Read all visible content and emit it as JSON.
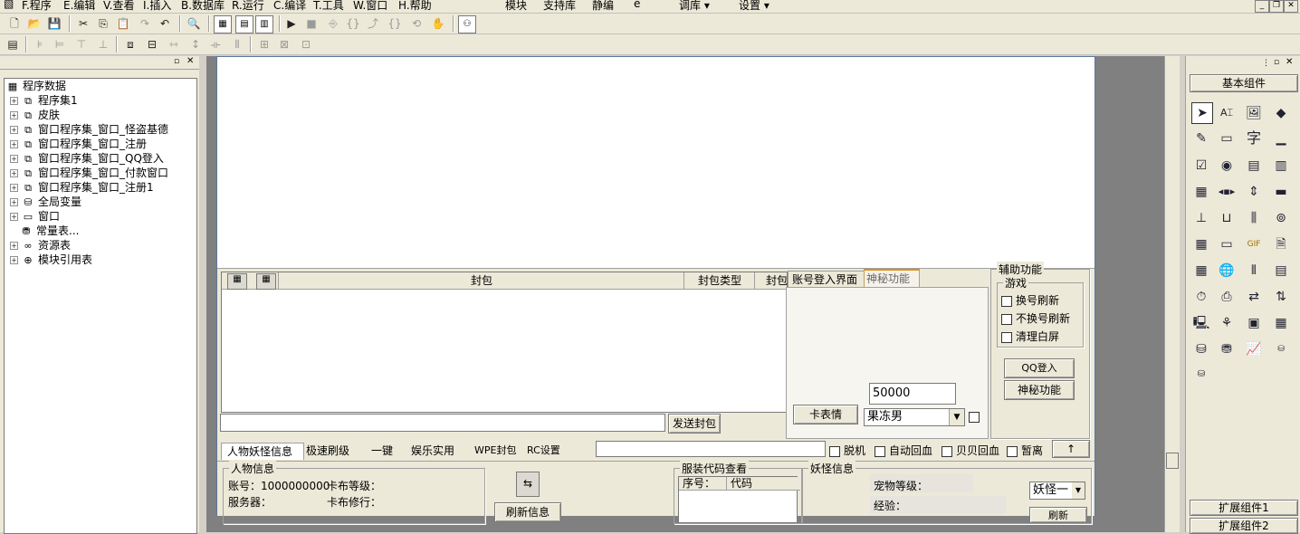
{
  "menu": {
    "items": [
      "F.程序",
      "E.编辑",
      "V.查看",
      "I.插入",
      "B.数据库",
      "R.运行",
      "C.编译",
      "T.工具",
      "W.窗口",
      "H.帮助",
      "模块",
      "支持库",
      "静编",
      "e"
    ],
    "extra": [
      "调库",
      "设置"
    ]
  },
  "icons": {
    "toolbar1": [
      "new-file-icon",
      "open-folder-icon",
      "save-icon",
      "cut-icon",
      "copy-icon",
      "paste-icon",
      "redo-icon",
      "undo-icon",
      "find-icon",
      "window-layout-1-icon",
      "window-layout-2-icon",
      "window-layout-3-icon",
      "run-icon",
      "stop-icon",
      "step-icon",
      "step-into-icon",
      "step-out-icon",
      "run-to-cursor-icon",
      "breakpoint-icon",
      "hand-icon",
      "binoculars-icon"
    ],
    "toolbar2": [
      "form-icon",
      "align-left-icon",
      "align-right-icon",
      "align-top-icon",
      "align-bottom-icon",
      "center-h-icon",
      "center-v-icon",
      "same-width-icon",
      "same-height-icon",
      "space-h-icon",
      "space-v-icon",
      "grid-icon"
    ]
  },
  "tree": {
    "root": "程序数据",
    "nodes": [
      "程序集1",
      "皮肤",
      "窗口程序集_窗口_怪盗基德",
      "窗口程序集_窗口_注册",
      "窗口程序集_窗口_QQ登入",
      "窗口程序集_窗口_付款窗口",
      "窗口程序集_窗口_注册1",
      "全局变量",
      "窗口",
      "常量表...",
      "资源表",
      "模块引用表"
    ]
  },
  "packet": {
    "columns": [
      "封包",
      "封包类型",
      "封包"
    ],
    "send_label": "发送封包",
    "input_value": ""
  },
  "acct_tabs": {
    "tab1": "账号登入界面",
    "tab2": "神秘功能",
    "card_button": "卡表情",
    "number_value": "50000",
    "combo_value": "果冻男"
  },
  "aux": {
    "title": "辅助功能",
    "game_title": "游戏",
    "checks": [
      "换号刷新",
      "不换号刷新",
      "清理白屏"
    ],
    "qq_button": "QQ登入",
    "mystery_button": "神秘功能"
  },
  "bottom_tabs": [
    "人物妖怪信息",
    "极速刷级",
    "一键",
    "娱乐实用",
    "WPE封包",
    "RC设置"
  ],
  "status_checks": [
    "脱机",
    "自动回血",
    "贝贝回血",
    "暂离"
  ],
  "up_button": "↑",
  "person": {
    "title": "人物信息",
    "account_label": "账号：1000000000",
    "server_label": "服务器：",
    "card_level_label": "卡布等级：",
    "card_cultivate_label": "卡布修行：",
    "refresh_button": "刷新信息"
  },
  "clothes": {
    "title": "服装代码查看",
    "col1": "序号：",
    "col2": "代码"
  },
  "monster": {
    "title": "妖怪信息",
    "pet_level": "宠物等级：",
    "exp": "经验：",
    "combo_value": "妖怪一",
    "refresh_button": "刷新"
  },
  "palette": {
    "basic_label": "基本组件",
    "ext1_label": "扩展组件1",
    "ext2_label": "扩展组件2",
    "cells": [
      "pointer-icon",
      "label-icon",
      "picture-icon",
      "shape-icon",
      "edit-icon",
      "frame-icon",
      "text-char-icon",
      "line-icon",
      "checkbox-icon",
      "radio-icon",
      "list-icon",
      "combo-icon",
      "grid-icon",
      "progress-icon",
      "scroll-icon",
      "slider-icon",
      "ruler-icon",
      "tabs-icon",
      "vscroll-icon",
      "timer-icon",
      "calendar-icon",
      "button-icon",
      "gif-icon",
      "doc-icon",
      "dates-icon",
      "globe-icon",
      "split-icon",
      "table-icon",
      "clock-icon",
      "printer-icon",
      "netflow-icon",
      "netbox-icon",
      "client-icon",
      "bug-icon",
      "window-icon",
      "db-grid-icon",
      "db-up-icon",
      "db-icon",
      "chart-icon",
      "odbc-icon",
      "odbc-down-icon"
    ]
  }
}
